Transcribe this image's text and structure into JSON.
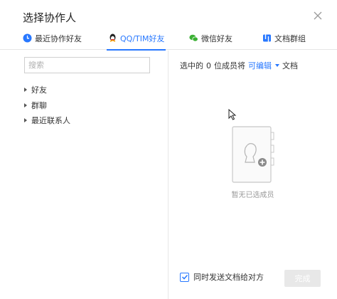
{
  "dialog": {
    "title": "选择协作人",
    "close_icon": "close-icon"
  },
  "tabs": [
    {
      "label": "最近协作好友",
      "icon": "clock-icon",
      "active": false
    },
    {
      "label": "QQ/TIM好友",
      "icon": "qq-penguin-icon",
      "active": true
    },
    {
      "label": "微信好友",
      "icon": "wechat-icon",
      "active": false
    },
    {
      "label": "文档群组",
      "icon": "group-icon",
      "active": false
    }
  ],
  "left": {
    "search_placeholder": "搜索",
    "tree": [
      {
        "label": "好友"
      },
      {
        "label": "群聊"
      },
      {
        "label": "最近联系人"
      }
    ]
  },
  "right": {
    "summary_prefix": "选中的",
    "selected_count": "0",
    "summary_middle": "位成员将",
    "permission": "可编辑",
    "summary_suffix": "文档",
    "empty_text": "暂无已选成员"
  },
  "footer": {
    "send_label": "同时发送文档给对方",
    "send_checked": true,
    "done_label": "完成"
  },
  "colors": {
    "accent": "#2878ff",
    "disabled_button": "#e8e8e8",
    "muted_text": "#999999"
  }
}
